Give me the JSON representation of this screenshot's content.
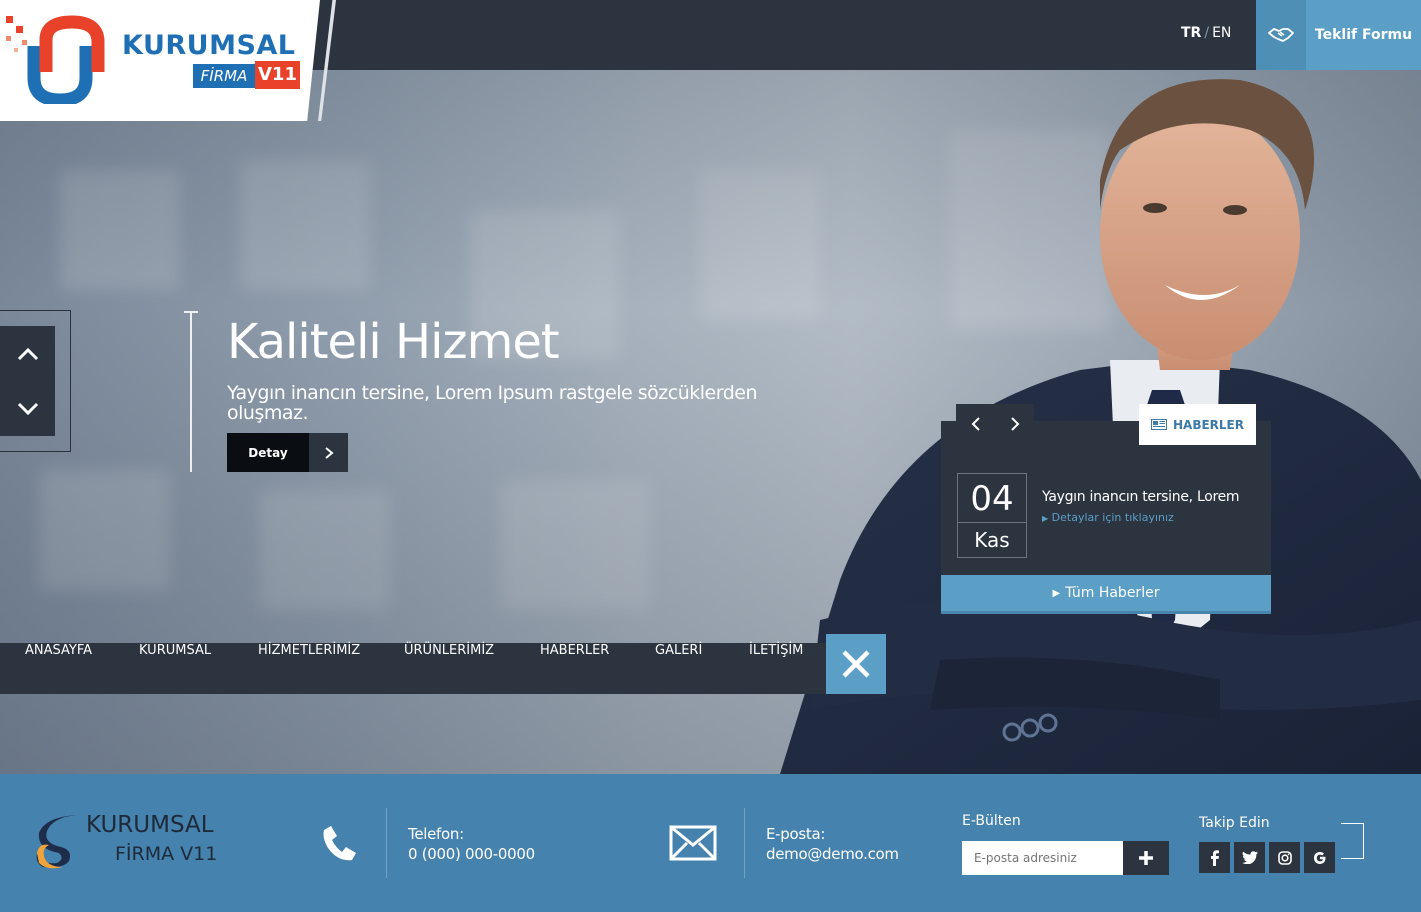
{
  "header": {
    "logo": {
      "word": "KURUMSAL",
      "firma": "FİRMA",
      "version": "V11"
    },
    "lang_tr": "TR",
    "lang_sep": "/",
    "lang_en": "EN",
    "handshake_icon": "handshake-icon",
    "offer_button": "Teklif Formu"
  },
  "slider": {
    "title": "Kaliteli Hizmet",
    "subtitle": "Yaygın inancın tersine, Lorem Ipsum rastgele sözcüklerden oluşmaz.",
    "detail_button": "Detay"
  },
  "nav": {
    "items": [
      "ANASAYFA",
      "KURUMSAL",
      "HİZMETLERİMİZ",
      "ÜRÜNLERİMİZ",
      "HABERLER",
      "GALERİ",
      "İLETİŞİM"
    ]
  },
  "news": {
    "tag": "HABERLER",
    "day": "04",
    "month": "Kas",
    "title": "Yaygın inancın tersine, Lorem",
    "link": "Detaylar için tıklayınız",
    "all_button": "Tüm Haberler"
  },
  "footer": {
    "logo_word": "KURUMSAL",
    "logo_firma": "FİRMA V11",
    "phone_label": "Telefon:",
    "phone_value": "0 (000) 000-0000",
    "email_label": "E-posta:",
    "email_value": "demo@demo.com",
    "newsletter_heading": "E-Bülten",
    "newsletter_placeholder": "E-posta adresiniz",
    "follow_heading": "Takip Edin",
    "social": [
      "f",
      "t",
      "ig",
      "G"
    ]
  },
  "colors": {
    "dark": "#2c3440",
    "accent": "#5b9ec6",
    "footer": "#4582ad",
    "logo_blue": "#1f6fb5",
    "logo_red": "#e8422a"
  }
}
